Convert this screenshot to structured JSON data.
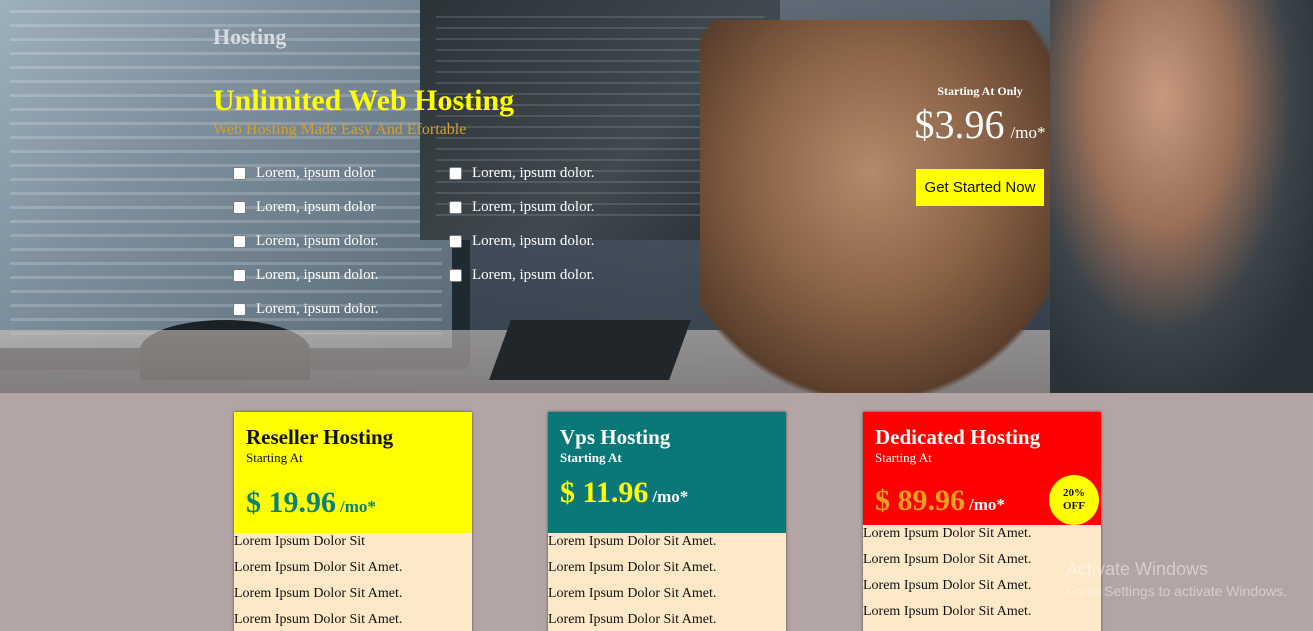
{
  "hero": {
    "brand": "Hosting",
    "title": "Unlimited Web Hosting",
    "subtitle": "Web Hosting Made Easy And Efortable",
    "features_left": [
      "Lorem, ipsum dolor",
      "Lorem, ipsum dolor",
      "Lorem, ipsum dolor.",
      "Lorem, ipsum dolor.",
      "Lorem, ipsum dolor."
    ],
    "features_right": [
      "Lorem, ipsum dolor.",
      "Lorem, ipsum dolor.",
      "Lorem, ipsum dolor.",
      "Lorem, ipsum dolor."
    ],
    "price_label": "Starting At Only",
    "price": "$3.96",
    "price_unit": "/mo*",
    "cta_label": "Get Started Now"
  },
  "plans": [
    {
      "name": "Reseller Hosting",
      "starting_label": "Starting At",
      "price": "$ 19.96",
      "unit": "/mo*",
      "color": "#ffff00",
      "items": [
        "Lorem Ipsum Dolor Sit",
        "Lorem Ipsum Dolor Sit Amet.",
        "Lorem Ipsum Dolor Sit Amet.",
        "Lorem Ipsum Dolor Sit Amet."
      ]
    },
    {
      "name": "Vps Hosting",
      "starting_label": "Starting At",
      "price": "$ 11.96",
      "unit": "/mo*",
      "color": "#0a7878",
      "items": [
        "Lorem Ipsum Dolor Sit Amet.",
        "Lorem Ipsum Dolor Sit Amet.",
        "Lorem Ipsum Dolor Sit Amet.",
        "Lorem Ipsum Dolor Sit Amet."
      ]
    },
    {
      "name": "Dedicated Hosting",
      "starting_label": "Starting At",
      "price": "$ 89.96",
      "unit": "/mo*",
      "color": "#ff0000",
      "badge_line1": "20%",
      "badge_line2": "OFF",
      "items": [
        "Lorem Ipsum Dolor Sit Amet.",
        "Lorem Ipsum Dolor Sit Amet.",
        "Lorem Ipsum Dolor Sit Amet.",
        "Lorem Ipsum Dolor Sit Amet."
      ]
    }
  ],
  "watermark": {
    "title": "Activate Windows",
    "subtitle": "Go to Settings to activate Windows."
  }
}
